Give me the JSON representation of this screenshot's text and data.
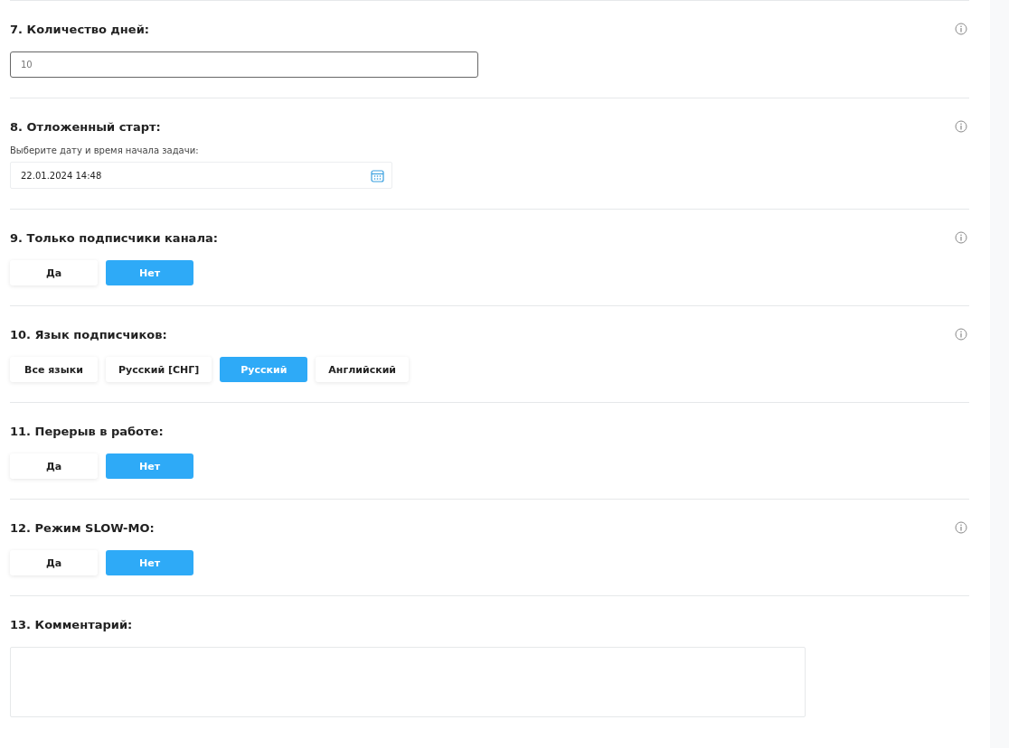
{
  "sections": [
    {
      "kind": "number",
      "title": "7. Количество дней:",
      "info": true,
      "value": "10"
    },
    {
      "kind": "datetime",
      "title": "8. Отложенный старт:",
      "info": true,
      "hint": "Выберите дату и время начала задачи:",
      "value": "22.01.2024 14:48"
    },
    {
      "kind": "choice",
      "title": "9. Только подписчики канала:",
      "info": true,
      "options": [
        {
          "label": "Да",
          "selected": false
        },
        {
          "label": "Нет",
          "selected": true
        }
      ]
    },
    {
      "kind": "choice",
      "title": "10. Язык подписчиков:",
      "info": true,
      "options": [
        {
          "label": "Все языки",
          "selected": false
        },
        {
          "label": "Русский [СНГ]",
          "selected": false
        },
        {
          "label": "Русский",
          "selected": true
        },
        {
          "label": "Английский",
          "selected": false
        }
      ]
    },
    {
      "kind": "choice",
      "title": "11. Перерыв в работе:",
      "info": false,
      "options": [
        {
          "label": "Да",
          "selected": false
        },
        {
          "label": "Нет",
          "selected": true
        }
      ]
    },
    {
      "kind": "choice",
      "title": "12. Режим SLOW-MO:",
      "info": true,
      "options": [
        {
          "label": "Да",
          "selected": false
        },
        {
          "label": "Нет",
          "selected": true
        }
      ]
    },
    {
      "kind": "textarea",
      "title": "13. Комментарий:",
      "info": false
    }
  ]
}
